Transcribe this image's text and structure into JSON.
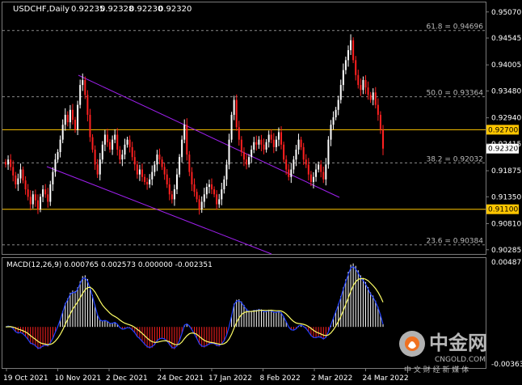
{
  "header": {
    "symbol": "USDCHF,Daily",
    "open": "0.92235",
    "high": "0.92328",
    "low": "0.92230",
    "close": "0.92320"
  },
  "price_axis": {
    "ticks": [
      "0.95070",
      "0.94545",
      "0.94005",
      "0.93480",
      "0.92940",
      "0.92415",
      "0.91875",
      "0.91350",
      "0.90810",
      "0.90285"
    ],
    "ylim": [
      0.902,
      0.9518
    ],
    "hlines": [
      {
        "value": 0.927,
        "label": "0.92700",
        "color": "#ffc600"
      },
      {
        "value": 0.911,
        "label": "0.91100",
        "color": "#ffc600"
      }
    ],
    "current": {
      "value": 0.9232,
      "label": "0.92320"
    }
  },
  "fibonacci": [
    {
      "value": 0.94696,
      "label": "61.8 = 0.94696"
    },
    {
      "value": 0.93364,
      "label": "50.0 = 0.93364"
    },
    {
      "value": 0.92032,
      "label": "38.2 = 0.92032"
    },
    {
      "value": 0.90384,
      "label": "23.6 = 0.90384"
    }
  ],
  "channel": {
    "color": "#a020f0"
  },
  "macd": {
    "label": "MACD(12,26,9) 0.000765 0.002573 0.000000 -0.002351",
    "ticks": [
      "0.00487",
      "-0.003631"
    ],
    "ylim": [
      -0.00363,
      0.00487
    ]
  },
  "time_axis": {
    "labels": [
      "19 Oct 2021",
      "10 Nov 2021",
      "2 Dec 2021",
      "24 Dec 2021",
      "17 Jan 2022",
      "8 Feb 2022",
      "2 Mar 2022",
      "24 Mar 2022"
    ]
  },
  "watermark": {
    "cn": "中金网",
    "site": "CNGOLD.COM",
    "sub": "中 文 财 经 新 媒 体"
  },
  "colors": {
    "bull": "#ffffff",
    "bear": "#ff2020",
    "grid": "#7a7a7a",
    "signal": "#ffff66",
    "macd_line": "#2040ff"
  },
  "chart_data": {
    "type": "candlestick",
    "title": "USDCHF,Daily",
    "ylim": [
      0.902,
      0.9518
    ],
    "closes": [
      0.92,
      0.921,
      0.9195,
      0.9178,
      0.916,
      0.9172,
      0.919,
      0.9168,
      0.915,
      0.9135,
      0.912,
      0.914,
      0.9128,
      0.911,
      0.9135,
      0.915,
      0.914,
      0.9125,
      0.916,
      0.9185,
      0.921,
      0.9225,
      0.925,
      0.928,
      0.93,
      0.9285,
      0.931,
      0.929,
      0.927,
      0.932,
      0.936,
      0.937,
      0.934,
      0.93,
      0.9255,
      0.923,
      0.92,
      0.918,
      0.921,
      0.924,
      0.926,
      0.9245,
      0.923,
      0.925,
      0.926,
      0.923,
      0.921,
      0.922,
      0.924,
      0.925,
      0.9235,
      0.9215,
      0.92,
      0.918,
      0.919,
      0.9175,
      0.9165,
      0.916,
      0.917,
      0.9185,
      0.92,
      0.922,
      0.921,
      0.9195,
      0.918,
      0.916,
      0.914,
      0.913,
      0.915,
      0.918,
      0.9215,
      0.925,
      0.928,
      0.922,
      0.9185,
      0.916,
      0.9145,
      0.913,
      0.911,
      0.9125,
      0.914,
      0.9155,
      0.916,
      0.915,
      0.914,
      0.912,
      0.913,
      0.915,
      0.917,
      0.92,
      0.925,
      0.93,
      0.933,
      0.9275,
      0.925,
      0.9225,
      0.921,
      0.92,
      0.9215,
      0.923,
      0.9245,
      0.924,
      0.925,
      0.924,
      0.923,
      0.9245,
      0.926,
      0.925,
      0.9235,
      0.925,
      0.9265,
      0.924,
      0.921,
      0.919,
      0.9175,
      0.919,
      0.921,
      0.923,
      0.925,
      0.9235,
      0.921,
      0.92,
      0.918,
      0.9165,
      0.9175,
      0.919,
      0.92,
      0.9185,
      0.917,
      0.92,
      0.925,
      0.928,
      0.9295,
      0.931,
      0.933,
      0.936,
      0.939,
      0.941,
      0.943,
      0.945,
      0.941,
      0.938,
      0.936,
      0.935,
      0.937,
      0.9355,
      0.934,
      0.933,
      0.9345,
      0.932,
      0.93,
      0.927,
      0.9232
    ]
  }
}
